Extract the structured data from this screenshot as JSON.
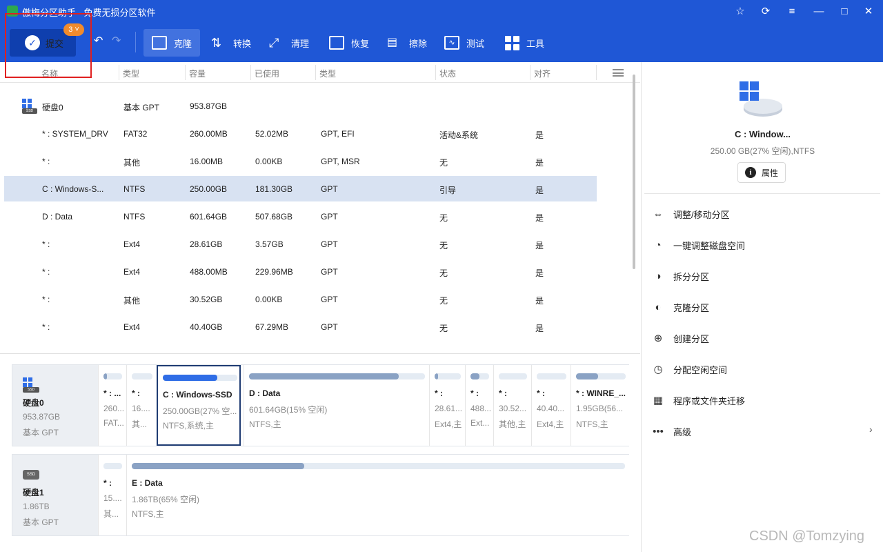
{
  "app": {
    "title": "傲梅分区助手 - 免费无损分区软件"
  },
  "window_controls": {
    "star": "☆",
    "refresh": "⟳",
    "menu": "≡",
    "minimize": "—",
    "maximize": "□",
    "close": "✕"
  },
  "toolbar": {
    "submit_label": "提交",
    "pending_count": "3",
    "tools": [
      {
        "label": "克隆",
        "icon": "clone-icon"
      },
      {
        "label": "转换",
        "icon": "convert-icon"
      },
      {
        "label": "清理",
        "icon": "clean-icon"
      },
      {
        "label": "恢复",
        "icon": "recover-icon"
      },
      {
        "label": "擦除",
        "icon": "wipe-icon"
      },
      {
        "label": "测试",
        "icon": "test-icon"
      },
      {
        "label": "工具",
        "icon": "tools-icon"
      }
    ]
  },
  "columns": [
    "名称",
    "类型",
    "容量",
    "已使用",
    "类型",
    "状态",
    "对齐"
  ],
  "rows": [
    {
      "name": "硬盘0",
      "type": "基本 GPT",
      "capacity": "953.87GB",
      "used": "",
      "ptype": "",
      "status": "",
      "align": ""
    },
    {
      "name": "* : SYSTEM_DRV",
      "type": "FAT32",
      "capacity": "260.00MB",
      "used": "52.02MB",
      "ptype": "GPT, EFI",
      "status": "活动&系统",
      "align": "是"
    },
    {
      "name": "* :",
      "type": "其他",
      "capacity": "16.00MB",
      "used": "0.00KB",
      "ptype": "GPT, MSR",
      "status": "无",
      "align": "是"
    },
    {
      "name": "C : Windows-S...",
      "type": "NTFS",
      "capacity": "250.00GB",
      "used": "181.30GB",
      "ptype": "GPT",
      "status": "引导",
      "align": "是"
    },
    {
      "name": "D : Data",
      "type": "NTFS",
      "capacity": "601.64GB",
      "used": "507.68GB",
      "ptype": "GPT",
      "status": "无",
      "align": "是"
    },
    {
      "name": "* :",
      "type": "Ext4",
      "capacity": "28.61GB",
      "used": "3.57GB",
      "ptype": "GPT",
      "status": "无",
      "align": "是"
    },
    {
      "name": "* :",
      "type": "Ext4",
      "capacity": "488.00MB",
      "used": "229.96MB",
      "ptype": "GPT",
      "status": "无",
      "align": "是"
    },
    {
      "name": "* :",
      "type": "其他",
      "capacity": "30.52GB",
      "used": "0.00KB",
      "ptype": "GPT",
      "status": "无",
      "align": "是"
    },
    {
      "name": "* :",
      "type": "Ext4",
      "capacity": "40.40GB",
      "used": "67.29MB",
      "ptype": "GPT",
      "status": "无",
      "align": "是"
    }
  ],
  "disks": [
    {
      "name": "硬盘0",
      "size": "953.87GB",
      "style": "基本 GPT",
      "partitions": [
        {
          "name": "* : ...",
          "size": "260...",
          "fs": "FAT...",
          "usage": 0.2
        },
        {
          "name": "* :",
          "size": "16....",
          "fs": "其...",
          "usage": 0.0
        },
        {
          "name": "C : Windows-SSD",
          "size": "250.00GB(27% 空...",
          "fs": "NTFS,系统,主",
          "usage": 0.73
        },
        {
          "name": "D : Data",
          "size": "601.64GB(15% 空闲)",
          "fs": "NTFS,主",
          "usage": 0.85
        },
        {
          "name": "* :",
          "size": "28.61...",
          "fs": "Ext4,主",
          "usage": 0.12
        },
        {
          "name": "* :",
          "size": "488....",
          "fs": "Ext...",
          "usage": 0.47
        },
        {
          "name": "* :",
          "size": "30.52...",
          "fs": "其他,主",
          "usage": 0.0
        },
        {
          "name": "* :",
          "size": "40.40...",
          "fs": "Ext4,主",
          "usage": 0.0
        },
        {
          "name": "* : WINRE_...",
          "size": "1.95GB(56...",
          "fs": "NTFS,主",
          "usage": 0.44
        }
      ]
    },
    {
      "name": "硬盘1",
      "size": "1.86TB",
      "style": "基本 GPT",
      "partitions": [
        {
          "name": "* :",
          "size": "15....",
          "fs": "其...",
          "usage": 0.0
        },
        {
          "name": "E : Data",
          "size": "1.86TB(65% 空闲)",
          "fs": "NTFS,主",
          "usage": 0.35
        }
      ]
    }
  ],
  "detail": {
    "name": "C : Window...",
    "info": "250.00 GB(27% 空闲),NTFS",
    "properties_label": "属性",
    "actions": [
      {
        "label": "调整/移动分区",
        "icon": "resize-icon"
      },
      {
        "label": "一键调整磁盘空间",
        "icon": "pie-adjust-icon"
      },
      {
        "label": "拆分分区",
        "icon": "split-icon"
      },
      {
        "label": "克隆分区",
        "icon": "clone-partition-icon"
      },
      {
        "label": "创建分区",
        "icon": "create-partition-icon"
      },
      {
        "label": "分配空闲空间",
        "icon": "allocate-icon"
      },
      {
        "label": "程序或文件夹迁移",
        "icon": "migrate-icon"
      },
      {
        "label": "高级",
        "icon": "more-icon"
      }
    ]
  },
  "watermark": "CSDN @Tomzying"
}
